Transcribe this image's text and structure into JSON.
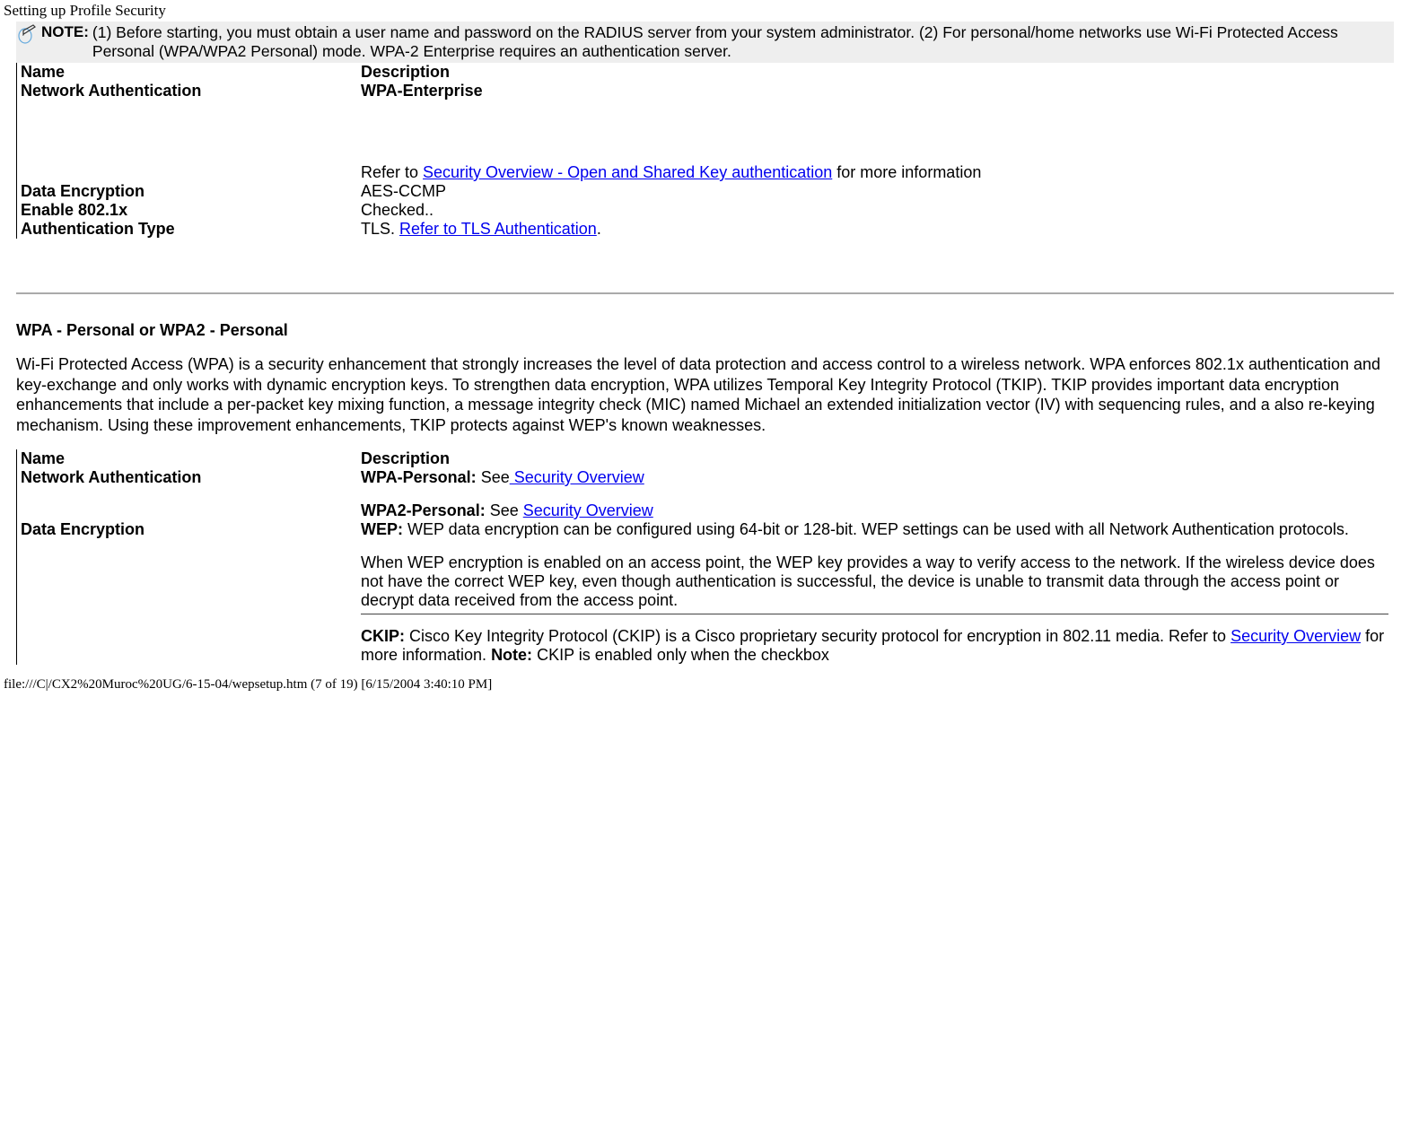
{
  "page_title": "Setting up Profile Security",
  "note": {
    "label": "NOTE:",
    "text": "(1) Before starting, you must obtain a user name and password on the RADIUS server from your system administrator. (2) For personal/home networks use Wi-Fi Protected Access Personal (WPA/WPA2 Personal) mode. WPA-2 Enterprise requires an authentication server."
  },
  "table1": {
    "header_name": "Name",
    "header_desc": "Description",
    "rows": {
      "netauth_label": "Network Authentication",
      "netauth_value": "WPA-Enterprise",
      "netauth_ref_prefix": "Refer to ",
      "netauth_ref_link": "Security Overview - Open and Shared Key authentication",
      "netauth_ref_suffix": " for more information",
      "dataenc_label": "Data Encryption",
      "dataenc_value": "AES-CCMP",
      "enable8021x_label": "Enable 802.1x",
      "enable8021x_value": "Checked..",
      "authtype_label": "Authentication Type",
      "authtype_prefix": "TLS. ",
      "authtype_link": "Refer to TLS Authentication",
      "authtype_suffix": "."
    }
  },
  "section2": {
    "heading": "WPA - Personal or WPA2 - Personal",
    "paragraph": "Wi-Fi Protected Access (WPA) is a security enhancement that strongly increases the level of data protection and access control to a wireless network. WPA enforces 802.1x authentication and key-exchange and only works with dynamic encryption keys. To strengthen data encryption, WPA utilizes Temporal Key Integrity Protocol (TKIP). TKIP provides important data encryption enhancements that include a per-packet key mixing function, a message integrity check (MIC) named Michael an extended initialization vector (IV) with sequencing rules, and a also re-keying mechanism. Using these improvement enhancements, TKIP protects against WEP's known weaknesses."
  },
  "table2": {
    "header_name": "Name",
    "header_desc": "Description",
    "rows": {
      "netauth_label": "Network Authentication",
      "wpa_personal_label": "WPA-Personal:",
      "wpa_personal_see": " See",
      "wpa_personal_link": " Security Overview",
      "wpa2_personal_label": "WPA2-Personal:",
      "wpa2_personal_see": " See ",
      "wpa2_personal_link": "Security Overview",
      "dataenc_label": "Data Encryption",
      "wep_label": "WEP:",
      "wep_text1": " WEP data encryption can be configured using 64-bit or 128-bit. WEP settings can be used with all Network Authentication protocols.",
      "wep_text2": "When WEP encryption is enabled on an access point, the WEP key provides a way to verify access to the network. If the wireless device does not have the correct WEP key, even though authentication is successful, the device is unable to transmit data through the access point or decrypt data received from the access point.",
      "ckip_label": "CKIP:",
      "ckip_text1": " Cisco Key Integrity Protocol (CKIP) is a Cisco proprietary security protocol for encryption in 802.11 media. Refer to ",
      "ckip_link": "Security Overview",
      "ckip_text2": " for more information. ",
      "ckip_note_label": "Note:",
      "ckip_text3": " CKIP is enabled only when the checkbox"
    }
  },
  "footer": "file:///C|/CX2%20Muroc%20UG/6-15-04/wepsetup.htm (7 of 19) [6/15/2004 3:40:10 PM]"
}
